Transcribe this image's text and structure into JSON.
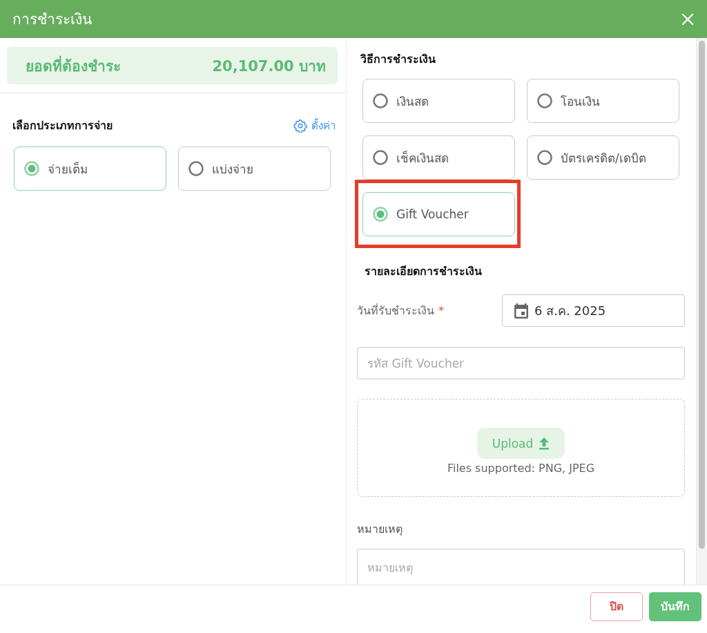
{
  "dialog": {
    "title": "การชำระเงิน"
  },
  "amount_due": {
    "label": "ยอดที่ต้องชำระ",
    "value": "20,107.00 บาท"
  },
  "payment_type": {
    "title": "เลือกประเภทการจ่าย",
    "settings_link": "ตั้งค่า",
    "options": [
      {
        "label": "จ่ายเต็ม",
        "selected": true
      },
      {
        "label": "แบ่งจ่าย",
        "selected": false
      }
    ]
  },
  "payment_method": {
    "title": "วิธีการชำระเงิน",
    "options": [
      {
        "label": "เงินสด",
        "selected": false,
        "highlighted": false
      },
      {
        "label": "โอนเงิน",
        "selected": false,
        "highlighted": false
      },
      {
        "label": "เช็คเงินสด",
        "selected": false,
        "highlighted": false
      },
      {
        "label": "บัตรเครดิต/เดบิต",
        "selected": false,
        "highlighted": false
      },
      {
        "label": "Gift Voucher",
        "selected": true,
        "highlighted": true
      }
    ]
  },
  "details": {
    "title": "รายละเอียดการชำระเงิน",
    "date_label": "วันที่รับชำระเงิน",
    "required_mark": "*",
    "date_value": "6 ส.ค. 2025",
    "voucher_code": {
      "placeholder": "รหัส Gift Voucher"
    },
    "upload": {
      "button": "Upload",
      "hint": "Files supported: PNG, JPEG"
    },
    "remarks": {
      "label": "หมายเหตุ",
      "placeholder": "หมายเหตุ"
    }
  },
  "footer": {
    "buttons": [
      {
        "label": "ปิด",
        "kind": "secondary"
      },
      {
        "label": "บันทึก",
        "kind": "primary"
      }
    ]
  }
}
